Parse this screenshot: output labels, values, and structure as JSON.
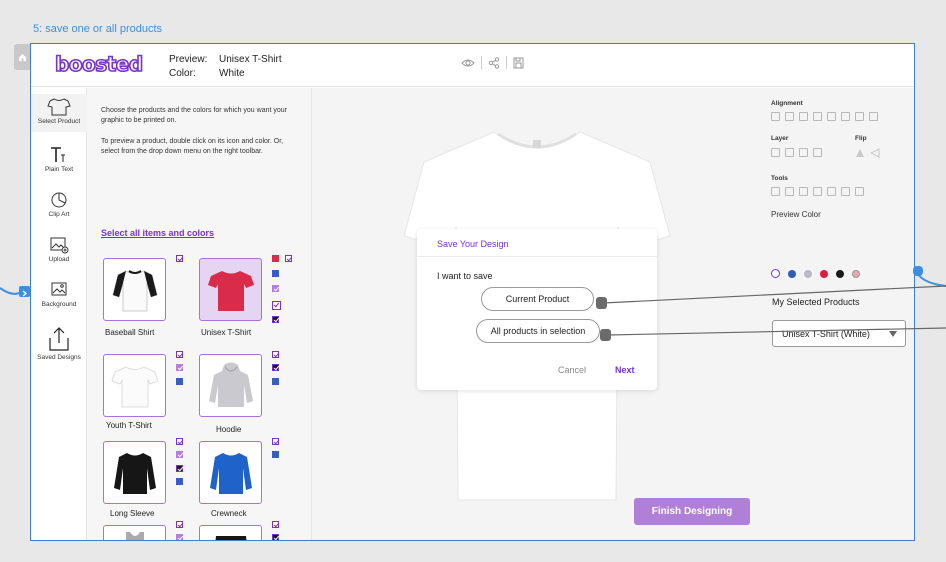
{
  "flow_label": "5: save one or all products",
  "app": {
    "logo_text": "boosted",
    "preview_label": "Preview:",
    "preview_value": "Unisex T-Shirt",
    "color_label": "Color:",
    "color_value": "White"
  },
  "toolnav": {
    "items": [
      {
        "label": "Select Product",
        "icon": "tshirt-outline-icon"
      },
      {
        "label": "Plain Text",
        "icon": "text-icon"
      },
      {
        "label": "Clip Art",
        "icon": "clipart-icon"
      },
      {
        "label": "Upload",
        "icon": "upload-image-icon"
      },
      {
        "label": "Background",
        "icon": "background-image-icon"
      },
      {
        "label": "Saved Designs",
        "icon": "share-upload-icon"
      }
    ]
  },
  "product_panel": {
    "intro": "Choose the products and the colors for which you want your graphic to be printed on.",
    "help": "To preview a product, double click on its icon and color. Or, select from the drop down menu on the right toolbar.",
    "select_all": "Select all items and colors",
    "products": [
      {
        "name": "Baseball Shirt",
        "selected": false
      },
      {
        "name": "Unisex T-Shirt",
        "selected": true
      },
      {
        "name": "Youth T-Shirt",
        "selected": false
      },
      {
        "name": "Hoodie",
        "selected": false
      },
      {
        "name": "Long Sleeve",
        "selected": false
      },
      {
        "name": "Crewneck",
        "selected": false
      },
      {
        "name": "",
        "selected": false
      },
      {
        "name": "",
        "selected": false
      }
    ]
  },
  "dialog": {
    "title": "Save Your Design",
    "question": "I want to save",
    "option_current": "Current Product",
    "option_all": "All products in selection",
    "cancel": "Cancel",
    "next": "Next"
  },
  "finish_button": "Finish Designing",
  "right_toolbar": {
    "alignment_label": "Alignment",
    "layer_label": "Layer",
    "flip_label": "Flip",
    "tools_label": "Tools",
    "preview_color_label": "Preview Color",
    "preview_colors": [
      "#ffffff",
      "#2b5fb0",
      "#b9b9c7",
      "#d91e3a",
      "#1a1a1a",
      "#e7a6b6"
    ],
    "my_selected_label": "My Selected Products",
    "dropdown_value": "Unisex T-Shirt (White)"
  },
  "colors": {
    "accent": "#7a33c9",
    "frame_border": "#3b7fd4",
    "connector": "#666666"
  }
}
